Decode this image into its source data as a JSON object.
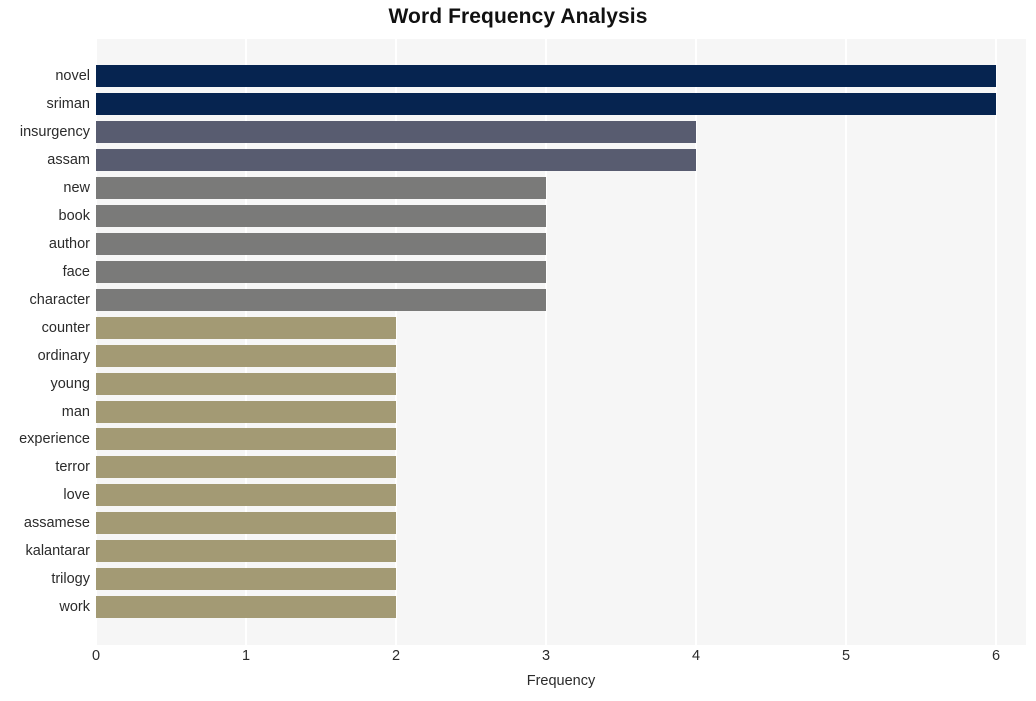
{
  "chart_data": {
    "type": "bar",
    "orientation": "horizontal",
    "title": "Word Frequency Analysis",
    "xlabel": "Frequency",
    "ylabel": "",
    "xlim": [
      0,
      6.2
    ],
    "xticks": [
      0,
      1,
      2,
      3,
      4,
      5,
      6
    ],
    "xtick_labels": [
      "0",
      "1",
      "2",
      "3",
      "4",
      "5",
      "6"
    ],
    "grid": "vertical",
    "legend": "none",
    "categories": [
      "novel",
      "sriman",
      "insurgency",
      "assam",
      "new",
      "book",
      "author",
      "face",
      "character",
      "counter",
      "ordinary",
      "young",
      "man",
      "experience",
      "terror",
      "love",
      "assamese",
      "kalantarar",
      "trilogy",
      "work"
    ],
    "values": [
      6,
      6,
      4,
      4,
      3,
      3,
      3,
      3,
      3,
      2,
      2,
      2,
      2,
      2,
      2,
      2,
      2,
      2,
      2,
      2
    ],
    "bar_colors": [
      "#062450",
      "#062450",
      "#585c70",
      "#585c70",
      "#7a7a79",
      "#7a7a79",
      "#7a7a79",
      "#7a7a79",
      "#7a7a79",
      "#a39a74",
      "#a39a74",
      "#a39a74",
      "#a39a74",
      "#a39a74",
      "#a39a74",
      "#a39a74",
      "#a39a74",
      "#a39a74",
      "#a39a74",
      "#a39a74"
    ]
  },
  "colors": {
    "figure_background": "#ffffff",
    "plot_background": "#f6f6f6",
    "grid": "#ffffff",
    "text": "#2b2b2b",
    "title": "#111111",
    "navy": "#062450",
    "slate": "#585c70",
    "gray": "#7a7a79",
    "khaki": "#a39a74"
  }
}
